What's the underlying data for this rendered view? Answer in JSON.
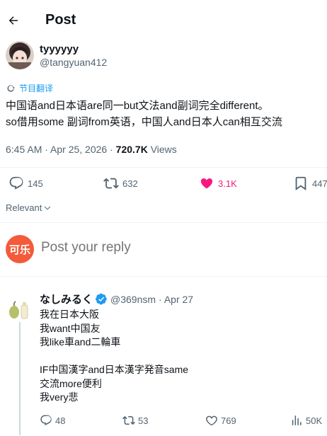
{
  "header": {
    "title": "Post"
  },
  "post": {
    "author_name": "tyyyyyy",
    "author_handle": "@tangyuan412",
    "translate_label": "节目翻译",
    "text": "中国语and日本语are同一but文法and副词完全different。\nso借用some 副词from英语，中国人and日本人can相互交流",
    "time": "6:45 AM · Apr 25, 2026 · ",
    "views_count": "720.7K",
    "views_label": " Views",
    "stats": {
      "replies": "145",
      "reposts": "632",
      "likes": "3.1K",
      "bookmarks": "447"
    },
    "liked": true
  },
  "sort_label": "Relevant",
  "reply_composer": {
    "avatar_text": "可乐",
    "placeholder": "Post your reply"
  },
  "reply": {
    "author_name": "なしみるく",
    "author_handle": "@369nsm",
    "date": " · Apr 27",
    "text": "我在日本大阪\n我want中国友\n我like車and二輪車\n\nIF中国漢字and日本漢字発音same\n交流more便利\n我very悲",
    "stats": {
      "replies": "48",
      "reposts": "53",
      "likes": "769",
      "views": "50K"
    }
  },
  "colors": {
    "accent": "#1d9bf0",
    "like": "#f91880",
    "muted": "#536471",
    "text": "#0f1419",
    "avatar_bg": "#f35b3a"
  },
  "icons": [
    "back-arrow-icon",
    "translate-icon",
    "reply-icon",
    "repost-icon",
    "heart-icon",
    "bookmark-icon",
    "chevron-down-icon",
    "verified-badge-icon",
    "views-icon"
  ]
}
